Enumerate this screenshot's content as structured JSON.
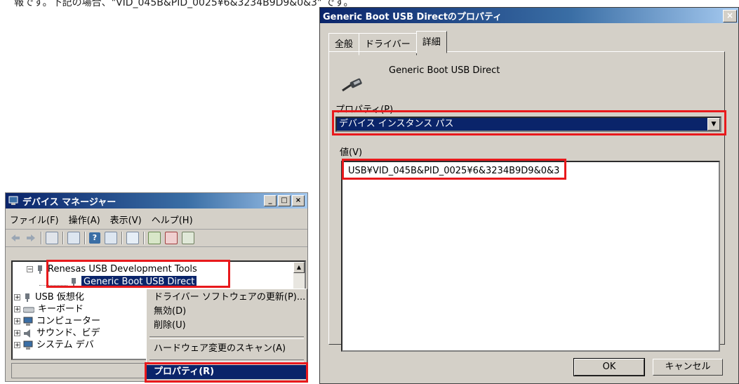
{
  "top_cropped_text": "報です。下記の場合、\"VID_045B&PID_0025¥6&3234B9D9&0&3\" です。",
  "device_manager": {
    "title": "デバイス マネージャー",
    "menu": [
      "ファイル(F)",
      "操作(A)",
      "表示(V)",
      "ヘルプ(H)"
    ],
    "tree": {
      "renesas": "Renesas USB Development Tools",
      "generic": "Generic Boot USB Direct",
      "usb_virtual": "USB 仮想化",
      "keyboard": "キーボード",
      "computer": "コンピューター",
      "sound": "サウンド、ビデ",
      "system": "システム デバ"
    }
  },
  "context_menu": {
    "update_driver": "ドライバー ソフトウェアの更新(P)...",
    "disable": "無効(D)",
    "uninstall": "削除(U)",
    "scan": "ハードウェア変更のスキャン(A)",
    "properties": "プロパティ(R)"
  },
  "properties_dialog": {
    "title": "Generic Boot USB Directのプロパティ",
    "tabs": [
      "全般",
      "ドライバー",
      "詳細"
    ],
    "device_name": "Generic Boot USB Direct",
    "property_label": "プロパティ(P)",
    "property_selected": "デバイス インスタンス パス",
    "value_label": "値(V)",
    "value": "USB¥VID_045B&PID_0025¥6&3234B9D9&0&3",
    "ok": "OK",
    "cancel": "キャンセル"
  },
  "colors": {
    "highlight": "#e8191c",
    "selection": "#0a246a",
    "face": "#d4d0c8"
  }
}
